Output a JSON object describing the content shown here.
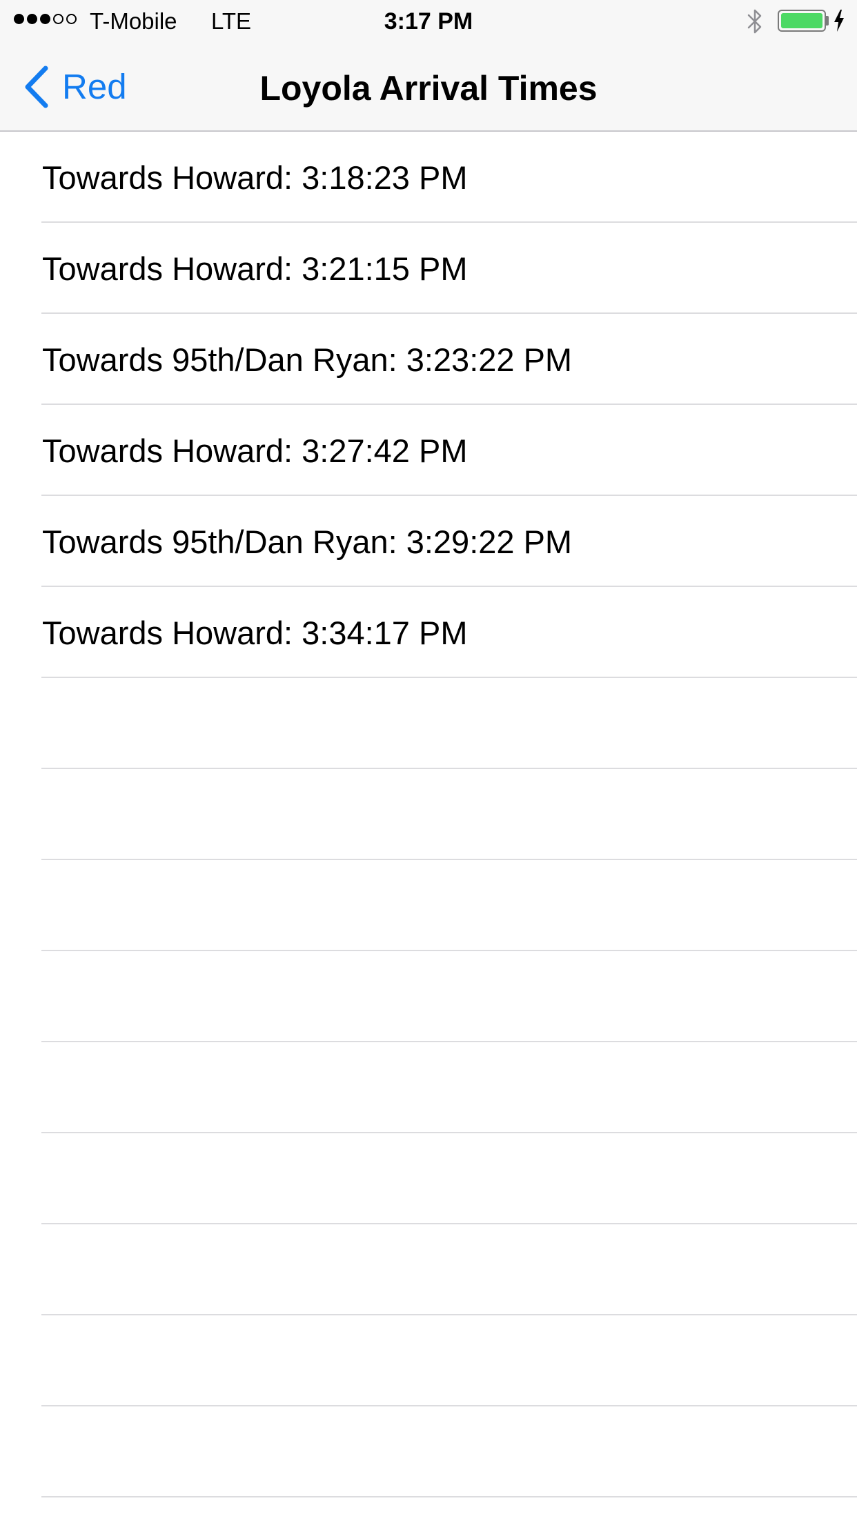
{
  "status_bar": {
    "carrier": "T-Mobile",
    "network": "LTE",
    "time": "3:17 PM",
    "signal_strength": 3,
    "signal_max": 5,
    "battery_level": 1.0,
    "battery_color": "#4cd964",
    "charging": true,
    "icons": [
      "signal-dots-icon",
      "bluetooth-icon",
      "battery-icon",
      "charging-bolt-icon"
    ]
  },
  "nav": {
    "back_label": "Red",
    "title": "Loyola Arrival Times",
    "accent_color": "#137cf0",
    "back_icon": "chevron-left-icon"
  },
  "arrivals": [
    {
      "label": "Towards Howard: 3:18:23 PM"
    },
    {
      "label": "Towards Howard: 3:21:15 PM"
    },
    {
      "label": "Towards 95th/Dan Ryan: 3:23:22 PM"
    },
    {
      "label": "Towards Howard: 3:27:42 PM"
    },
    {
      "label": "Towards 95th/Dan Ryan: 3:29:22 PM"
    },
    {
      "label": "Towards Howard: 3:34:17 PM"
    },
    {
      "label": ""
    },
    {
      "label": ""
    },
    {
      "label": ""
    },
    {
      "label": ""
    },
    {
      "label": ""
    },
    {
      "label": ""
    },
    {
      "label": ""
    },
    {
      "label": ""
    },
    {
      "label": ""
    }
  ]
}
